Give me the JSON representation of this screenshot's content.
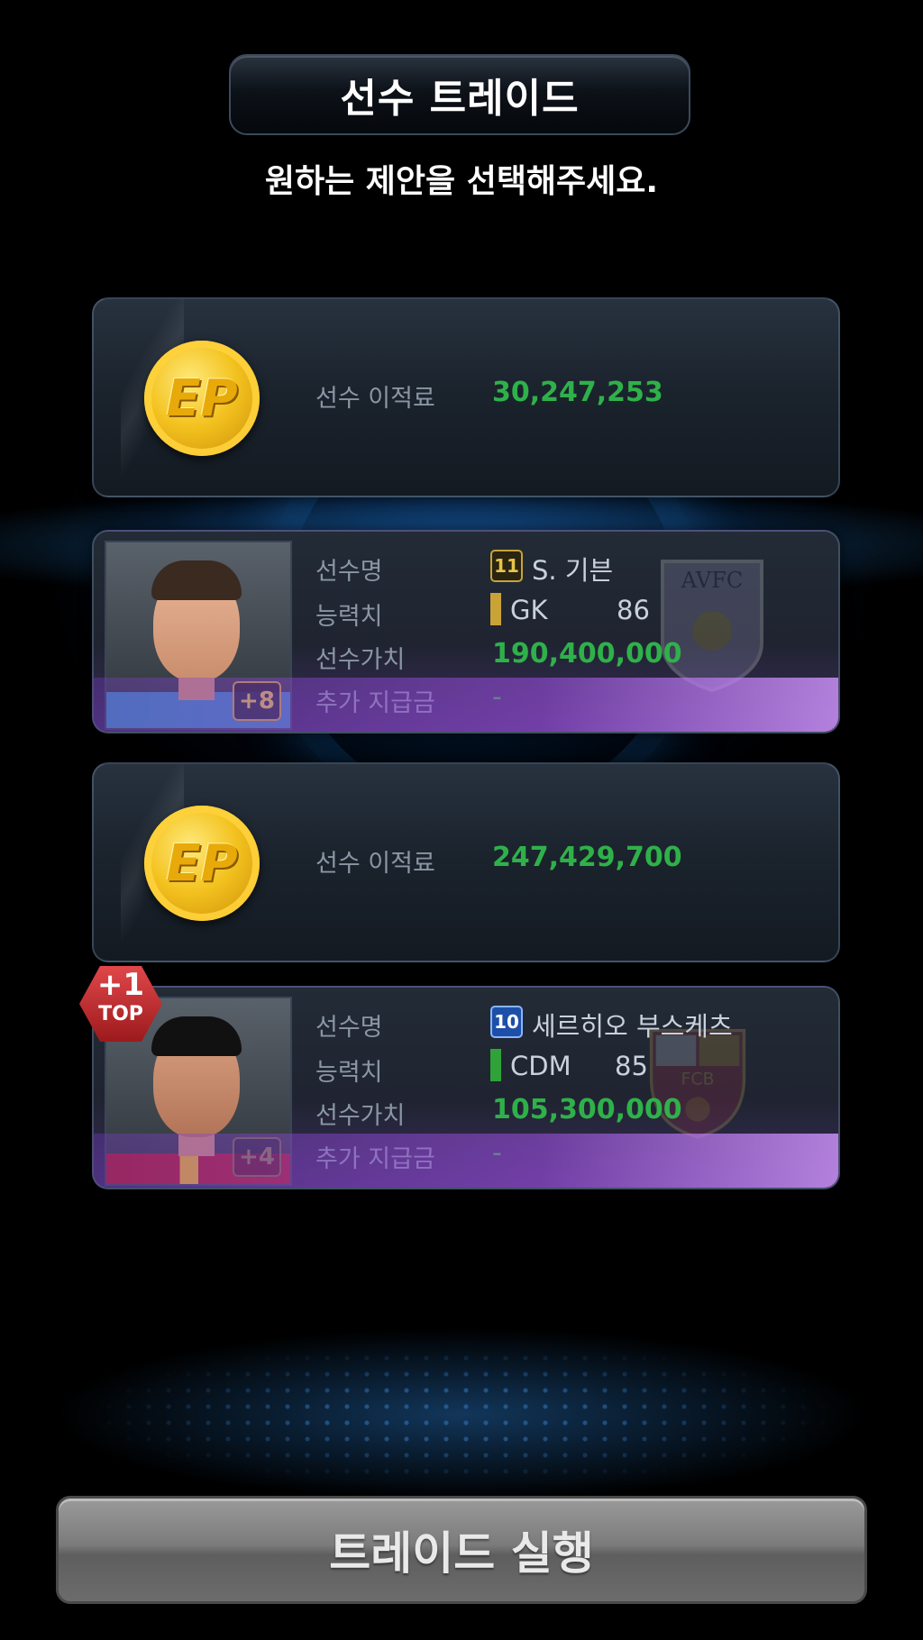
{
  "header": {
    "title": "선수 트레이드",
    "subtitle": "원하는 제안을 선택해주세요."
  },
  "offers": [
    {
      "type": "money",
      "coin_label": "EP",
      "label": "선수 이적료",
      "value": "30,247,253"
    },
    {
      "type": "player",
      "name_label": "선수명",
      "number": "11",
      "name": "S. 기븐",
      "ability_label": "능력치",
      "position": "GK",
      "position_color": "#c9a338",
      "rating": "86",
      "value_label": "선수가치",
      "value": "190,400,000",
      "extra_label": "추가 지급금",
      "extra": "-",
      "enhance": "+8",
      "club_crest": "AVFC",
      "top_badge": false
    },
    {
      "type": "money",
      "coin_label": "EP",
      "label": "선수 이적료",
      "value": "247,429,700"
    },
    {
      "type": "player",
      "name_label": "선수명",
      "number": "10",
      "name": "세르히오 부스케츠",
      "ability_label": "능력치",
      "position": "CDM",
      "position_color": "#2fa33a",
      "rating": "85",
      "value_label": "선수가치",
      "value": "105,300,000",
      "extra_label": "추가 지급금",
      "extra": "-",
      "enhance": "+4",
      "club_crest": "FCB",
      "top_badge": true,
      "top_badge_plus": "+1",
      "top_badge_text": "TOP"
    }
  ],
  "footer": {
    "execute_label": "트레이드 실행"
  },
  "colors": {
    "value_green": "#2fb14a",
    "label_gray": "#8a96a4",
    "button_gray": "#7b7b7b"
  }
}
